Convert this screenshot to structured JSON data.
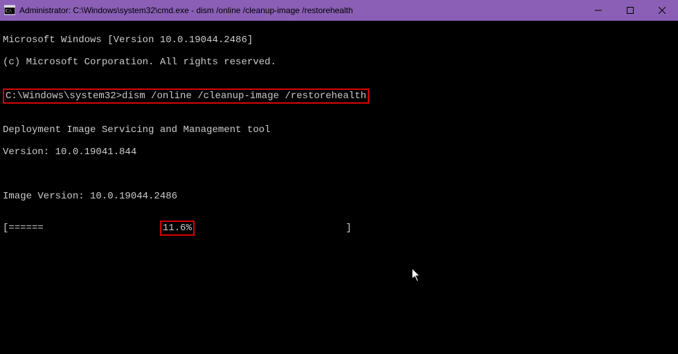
{
  "window": {
    "title": "Administrator: C:\\Windows\\system32\\cmd.exe - dism  /online /cleanup-image /restorehealth"
  },
  "terminal": {
    "banner1": "Microsoft Windows [Version 10.0.19044.2486]",
    "banner2": "(c) Microsoft Corporation. All rights reserved.",
    "prompt": "C:\\Windows\\system32>",
    "command": "dism /online /cleanup-image /restorehealth",
    "tool_line": "Deployment Image Servicing and Management tool",
    "tool_version": "Version: 10.0.19041.844",
    "image_version": "Image Version: 10.0.19044.2486",
    "progress_prefix": "[======                    ",
    "progress_pct": "11.6%",
    "progress_suffix": "                          ]"
  }
}
